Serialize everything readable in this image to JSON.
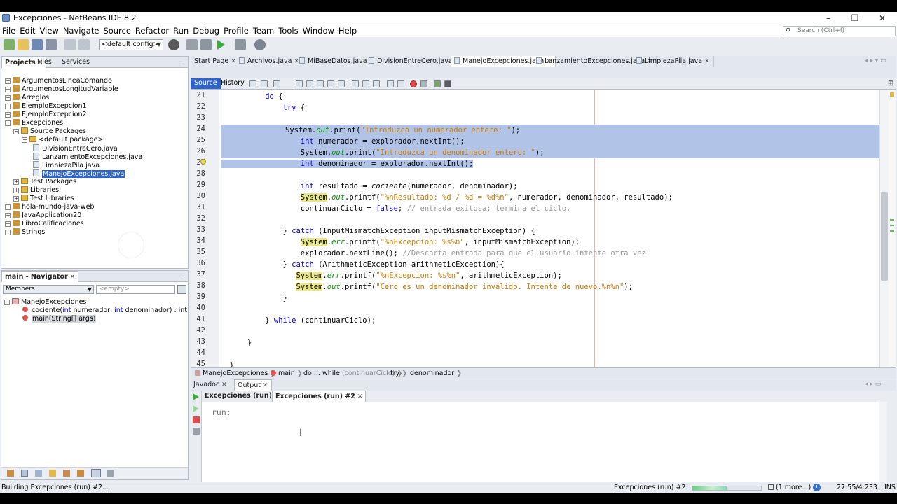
{
  "window": {
    "title": "Excepciones - NetBeans IDE 8.2",
    "minimize": "–",
    "maximize": "❐",
    "close": "✕"
  },
  "menubar": {
    "items": [
      "File",
      "Edit",
      "View",
      "Navigate",
      "Source",
      "Refactor",
      "Run",
      "Debug",
      "Profile",
      "Team",
      "Tools",
      "Window",
      "Help"
    ],
    "search_placeholder": "Search (Ctrl+I)"
  },
  "toolbar": {
    "config": "<default config>"
  },
  "projects_panel": {
    "tabs": [
      "Projects",
      "Files",
      "Services"
    ],
    "tree": [
      {
        "label": "ArgumentosLineaComando",
        "type": "project",
        "expander": "+"
      },
      {
        "label": "ArgumentosLongitudVariable",
        "type": "project",
        "expander": "+"
      },
      {
        "label": "Arreglos",
        "type": "project",
        "expander": "+"
      },
      {
        "label": "EjemploExcepcion1",
        "type": "project",
        "expander": "+"
      },
      {
        "label": "EjemploExcepcion2",
        "type": "project",
        "expander": "+"
      },
      {
        "label": "Excepciones",
        "type": "project",
        "expander": "−"
      },
      {
        "label": "Source Packages",
        "type": "package",
        "expander": "−"
      },
      {
        "label": "<default package>",
        "type": "package",
        "expander": "−"
      },
      {
        "label": "DivisionEntreCero.java",
        "type": "file",
        "expander": ""
      },
      {
        "label": "LanzamientoExcepciones.java",
        "type": "file",
        "expander": ""
      },
      {
        "label": "LimpiezaPila.java",
        "type": "file",
        "expander": ""
      },
      {
        "label": "ManejoExcepciones.java",
        "type": "file",
        "expander": "",
        "selected": true
      },
      {
        "label": "Test Packages",
        "type": "package",
        "expander": "+"
      },
      {
        "label": "Libraries",
        "type": "package",
        "expander": "+"
      },
      {
        "label": "Test Libraries",
        "type": "package",
        "expander": "+"
      },
      {
        "label": "hola-mundo-java-web",
        "type": "project",
        "expander": "+"
      },
      {
        "label": "JavaApplication20",
        "type": "project",
        "expander": "+"
      },
      {
        "label": "LibroCalificaciones",
        "type": "project",
        "expander": "+"
      },
      {
        "label": "Strings",
        "type": "project",
        "expander": "+"
      }
    ]
  },
  "navigator": {
    "tab": "main - Navigator",
    "filter": "Members",
    "empty": "<empty>",
    "class_name": "ManejoExcepciones",
    "members": [
      {
        "prefix": "cociente(",
        "p1t": "int",
        "p1": " numerador, ",
        "p2t": "int",
        "p2": " denominador) : int",
        "highlight": false
      },
      {
        "prefix": "main(String[] args)",
        "p1t": "",
        "p1": "",
        "p2t": "",
        "p2": "",
        "highlight": true
      }
    ]
  },
  "editor": {
    "tabs": [
      "Start Page",
      "Archivos.java",
      "MiBaseDatos.java",
      "DivisionEntreCero.java",
      "ManejoExcepciones.java",
      "LanzamientoExcepciones.java",
      "LimpiezaPila.java"
    ],
    "active_tab": 4,
    "source_label": "Source",
    "history_label": "History",
    "line_numbers": [
      "21",
      "22",
      "23",
      "24",
      "25",
      "26",
      "27",
      "28",
      "29",
      "30",
      "31",
      "32",
      "33",
      "34",
      "35",
      "36",
      "37",
      "38",
      "39",
      "40",
      "41",
      "42",
      "43",
      "44",
      "45"
    ],
    "code": {
      "l21_kw": "do",
      "l21_rest": " {",
      "l22_kw": "try",
      "l22_rest": " {",
      "l24_a": "System.",
      "l24_f": "out",
      "l24_b": ".print(",
      "l24_s": "\"Introduzca un numerador entero: \"",
      "l24_c": ");",
      "l25_kw": "int",
      "l25_rest": " numerador = explorador.nextInt();",
      "l26_a": "System.",
      "l26_f": "out",
      "l26_b": ".print(",
      "l26_s": "\"Introduzca un denominador entero: \"",
      "l26_c": ");",
      "l27_kw": "int",
      "l27_rest": " denominador = explorador.nextInt();",
      "l29_kw": "int",
      "l29_a": " resultado = ",
      "l29_i": "cociente",
      "l29_b": "(numerador, denominador);",
      "l30_sys": "System",
      "l30_a": ".",
      "l30_f": "out",
      "l30_b": ".printf(",
      "l30_s": "\"%nResultado: %d / %d = %d%n\"",
      "l30_c": ", numerador, denominador, resultado);",
      "l31_a": "continuarCiclo = ",
      "l31_kw": "false",
      "l31_b": "; ",
      "l31_cmt": "// entrada exitosa; termina el ciclo.",
      "l33_a": "} ",
      "l33_kw": "catch",
      "l33_b": " (InputMismatchException inputMismatchException) {",
      "l34_sys": "System",
      "l34_a": ".",
      "l34_f": "err",
      "l34_b": ".printf(",
      "l34_s": "\"%nExcepcion: %s%n\"",
      "l34_c": ", inputMismatchException);",
      "l35_a": "explorador.nextLine(); ",
      "l35_cmt": "//Descarta entrada para que el usuario intente otra vez",
      "l36_a": "} ",
      "l36_kw": "catch",
      "l36_b": " (ArithmeticException arithmeticException){",
      "l37_sys": "System",
      "l37_a": ".",
      "l37_f": "err",
      "l37_b": ".printf(",
      "l37_s": "\"%nExcepcion: %s%n\"",
      "l37_c": ", arithmeticException);",
      "l38_sys": "System",
      "l38_a": ".",
      "l38_f": "out",
      "l38_b": ".printf(",
      "l38_s": "\"Cero es un denominador inválido. Intente de nuevo.%n%n\"",
      "l38_c": ");",
      "l39": "}",
      "l41_a": "} ",
      "l41_kw": "while",
      "l41_b": " (continuarCiclo);",
      "l43": "}",
      "l45": "}"
    },
    "breadcrumbs": [
      {
        "label": "ManejoExcepciones",
        "dim": ""
      },
      {
        "label": "main",
        "dim": ""
      },
      {
        "label": "do ... while ",
        "dim": "(continuarCiclo)"
      },
      {
        "label": "try",
        "dim": ""
      },
      {
        "label": "denominador",
        "dim": ""
      }
    ]
  },
  "output": {
    "tabs": [
      "Javadoc",
      "Output"
    ],
    "subtabs": [
      "Excepciones (run)",
      "Excepciones (run) #2"
    ],
    "text": "run:"
  },
  "statusbar": {
    "left": "Building Excepciones (run) #2...",
    "task": "Excepciones (run) #2",
    "more": "(1 more...)",
    "position": "27:55/4:233",
    "mode": "INS",
    "progress": 0.5
  }
}
